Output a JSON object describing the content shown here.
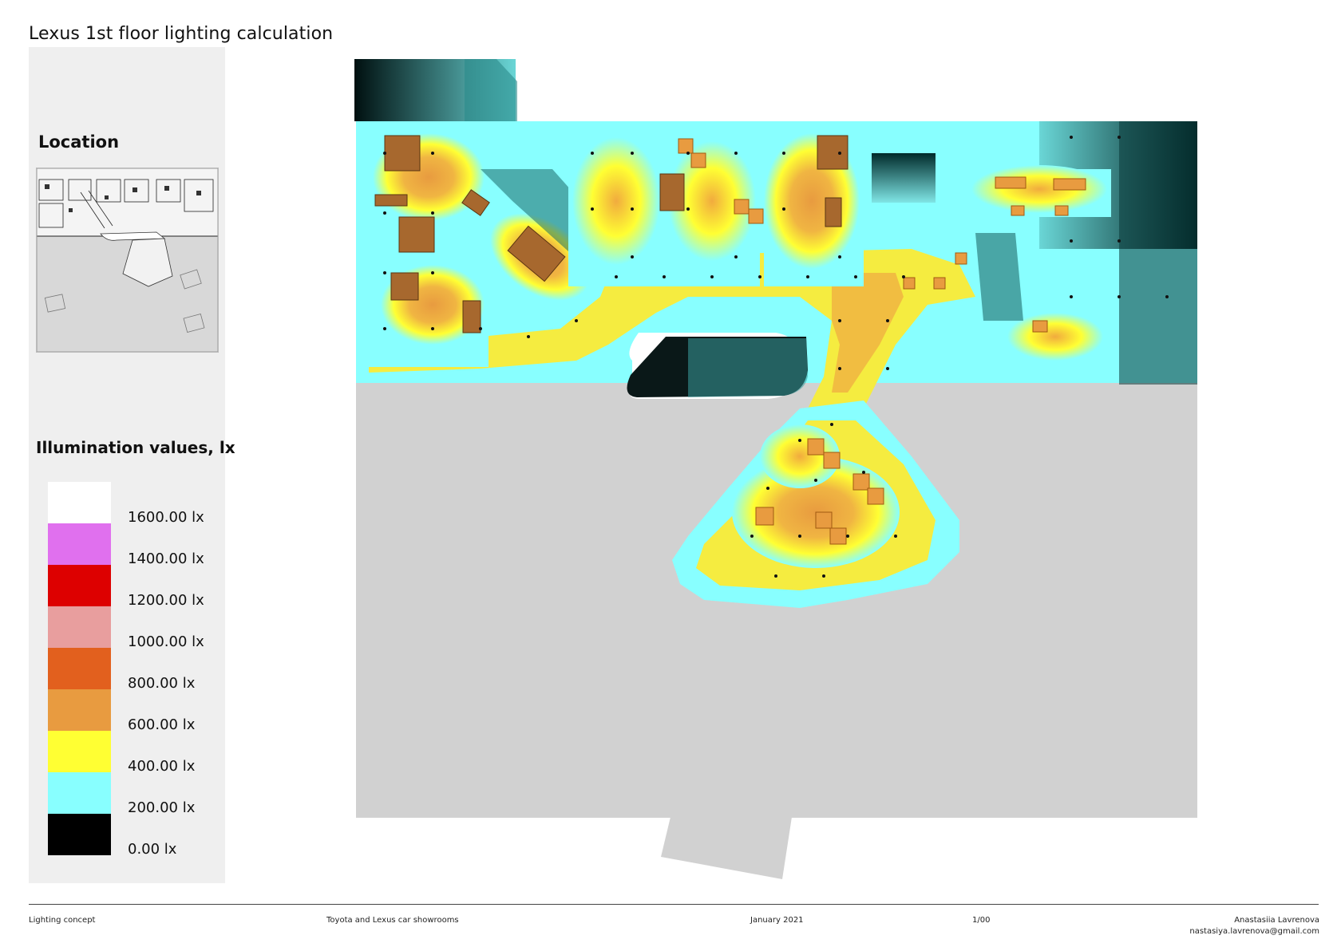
{
  "header": {
    "title": "Lexus 1st floor lighting calculation"
  },
  "sidebar": {
    "location_title": "Location",
    "illumination_title": "Illumination values, lx",
    "legend": [
      {
        "color": "#ffffff",
        "label": "1600.00 lx"
      },
      {
        "color": "#e070ee",
        "label": "1400.00 lx"
      },
      {
        "color": "#dd0000",
        "label": "1200.00 lx"
      },
      {
        "color": "#e89e9e",
        "label": "1000.00 lx"
      },
      {
        "color": "#e2601e",
        "label": "800.00 lx"
      },
      {
        "color": "#e89b40",
        "label": "600.00 lx"
      },
      {
        "color": "#ffff33",
        "label": "400.00 lx"
      },
      {
        "color": "#88ffff",
        "label": "200.00 lx"
      },
      {
        "color": "#000000",
        "label": "0.00 lx"
      }
    ]
  },
  "footer": {
    "concept": "Lighting concept",
    "project": "Toyota and Lexus car showrooms",
    "date": "January 2021",
    "page": "1/00",
    "author": "Anastasiia Lavrenova",
    "email": "nastasiya.lavrenova@gmail.com"
  }
}
